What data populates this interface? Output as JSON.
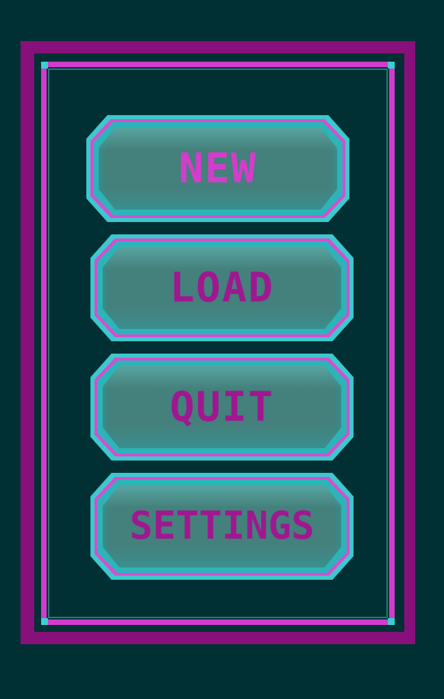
{
  "menu": {
    "buttons": [
      {
        "id": "new",
        "label": "NEW"
      },
      {
        "id": "load",
        "label": "LOAD"
      },
      {
        "id": "quit",
        "label": "QUIT"
      },
      {
        "id": "settings",
        "label": "SETTINGS"
      }
    ]
  },
  "colors": {
    "background": "#003034",
    "frame_outer": "#88107a",
    "frame_inner": "#d23ccc",
    "button_border": "#3cc8cc",
    "button_face": "#44807c",
    "label_active": "#d63ccc",
    "label_dim": "#a01890"
  }
}
